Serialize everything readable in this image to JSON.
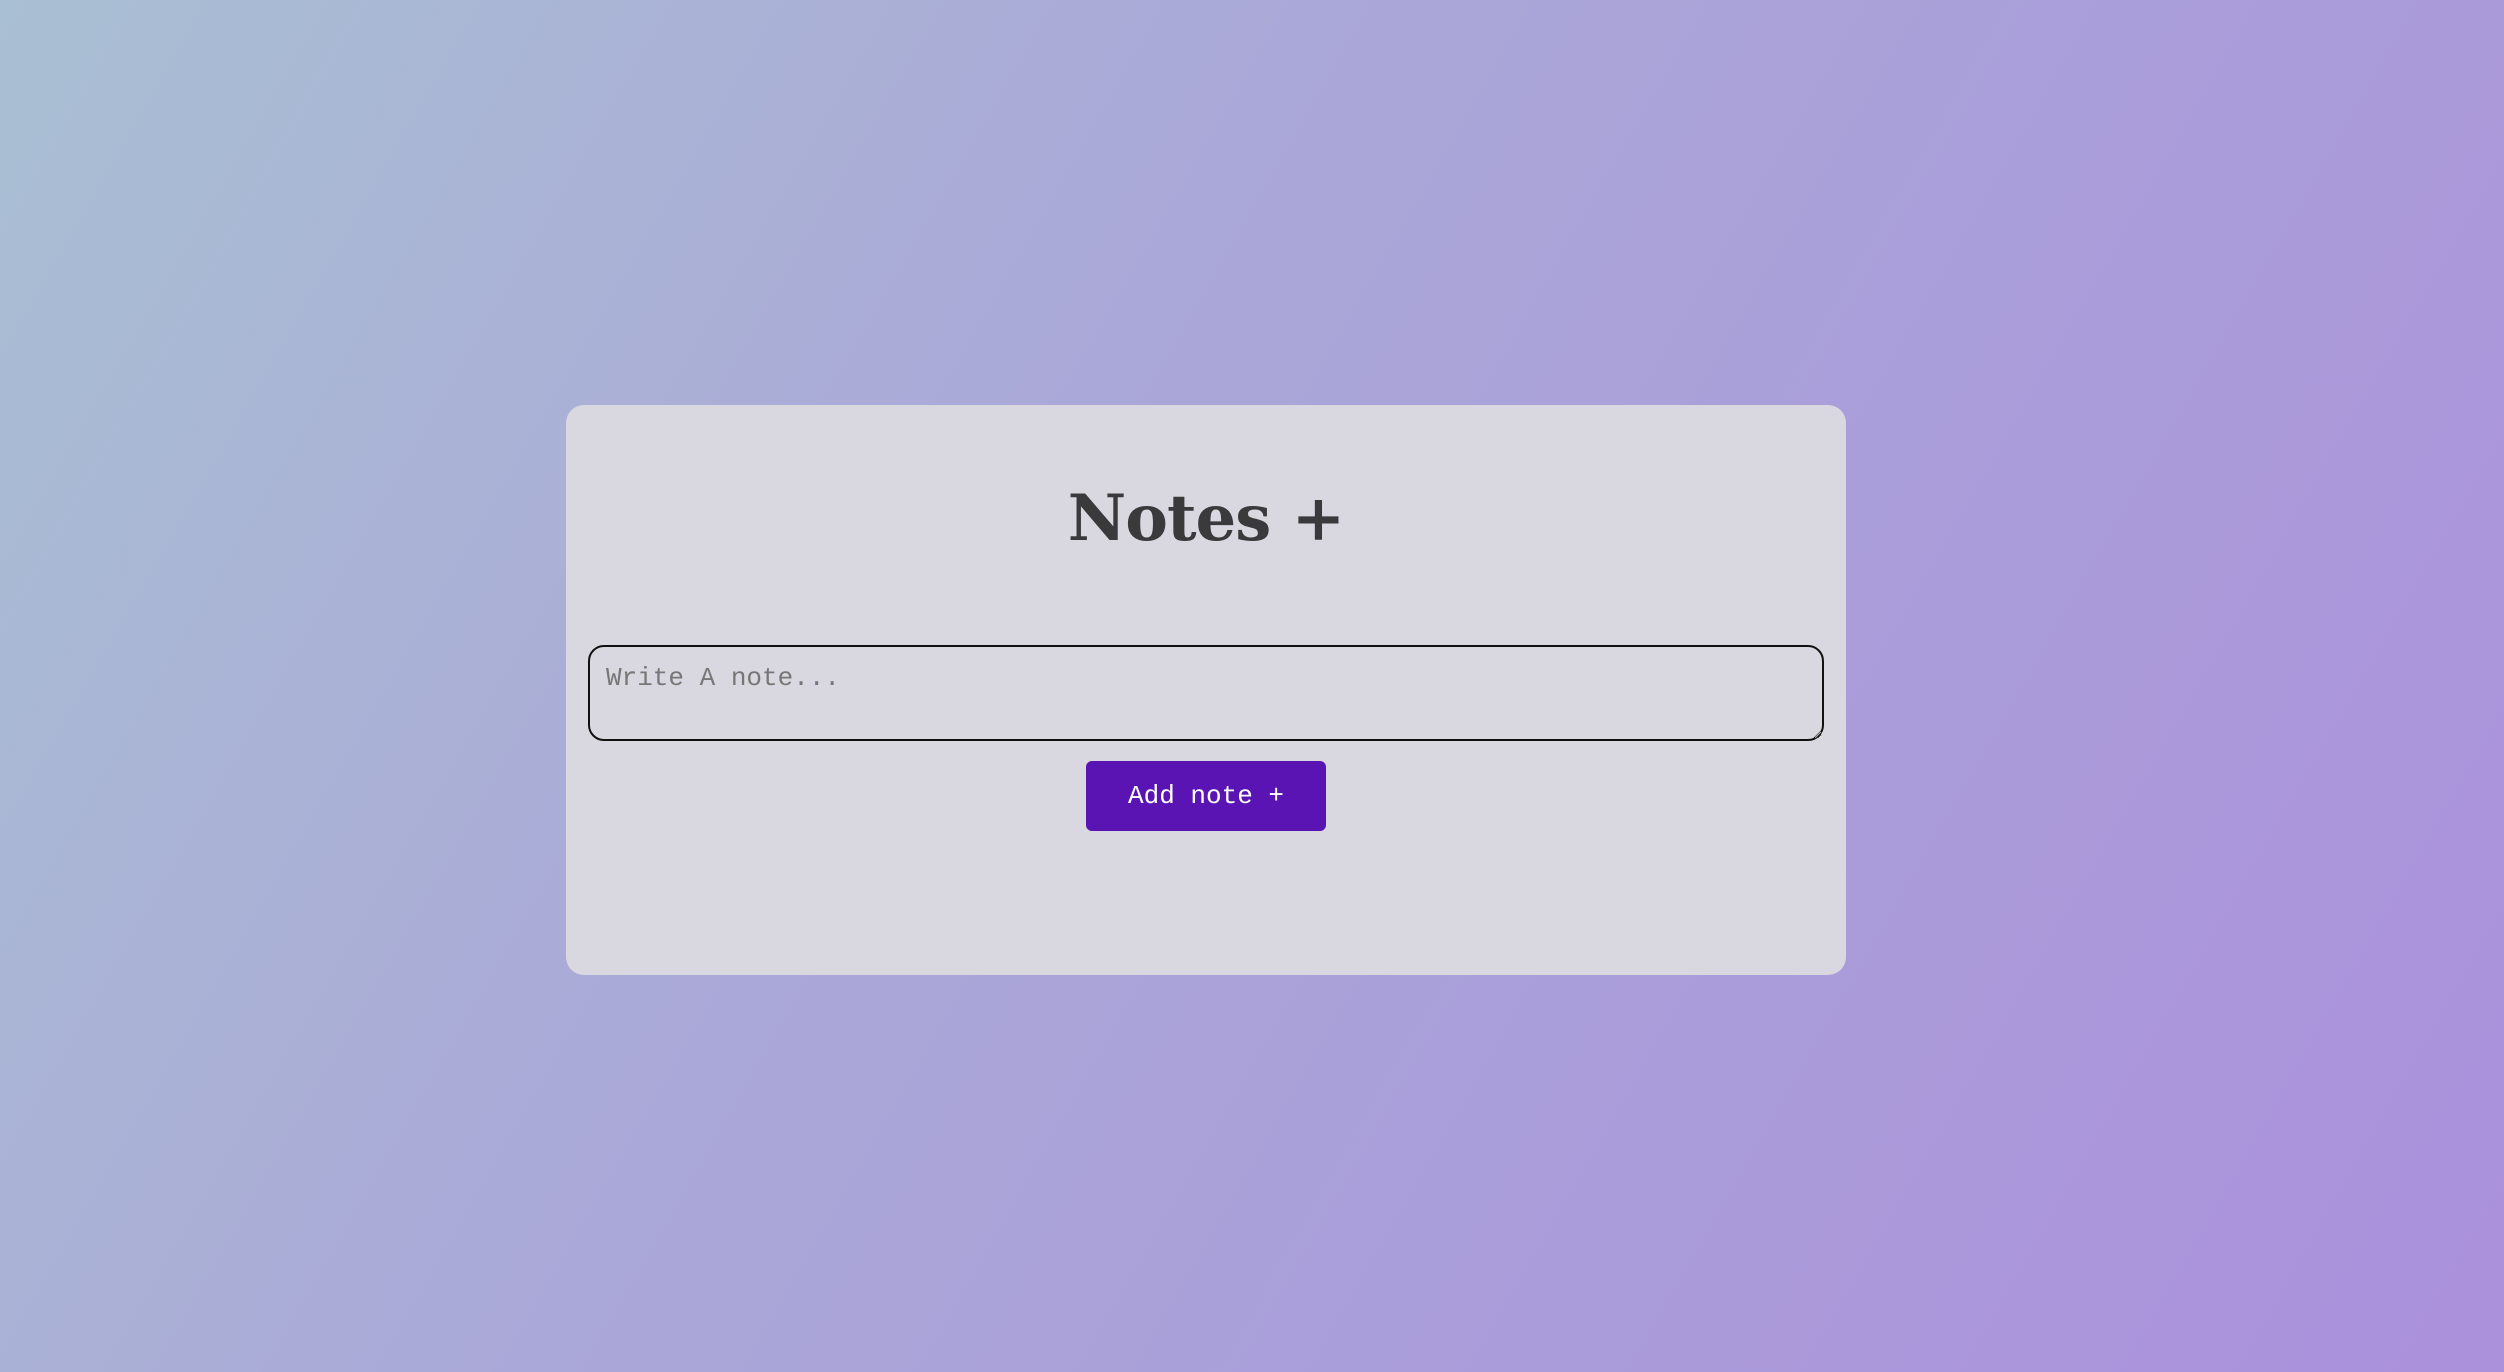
{
  "app": {
    "title": "Notes +"
  },
  "note_form": {
    "input_placeholder": "Write A note...",
    "input_value": "",
    "add_button_label": "Add note +"
  },
  "colors": {
    "accent": "#5a14b4",
    "card_background": "#d9d8e0",
    "title_text": "#3a3a3d"
  }
}
